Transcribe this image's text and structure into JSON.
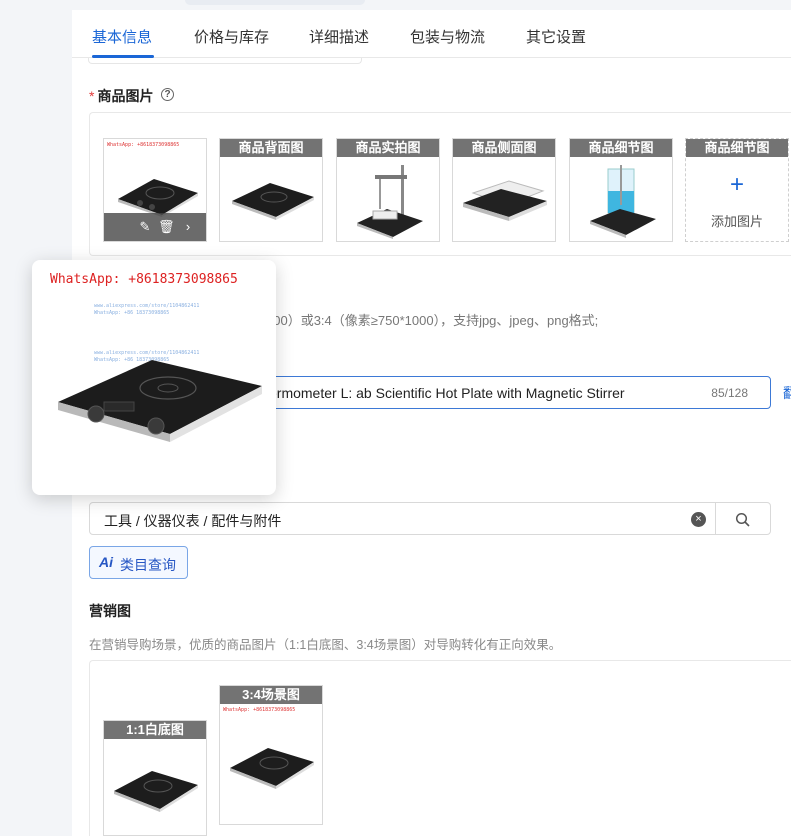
{
  "tabs": [
    {
      "label": "基本信息",
      "active": true
    },
    {
      "label": "价格与库存",
      "active": false
    },
    {
      "label": "详细描述",
      "active": false
    },
    {
      "label": "包装与物流",
      "active": false
    },
    {
      "label": "其它设置",
      "active": false
    }
  ],
  "product_images": {
    "required_mark": "*",
    "label": "商品图片",
    "help_glyph": "?",
    "watermark": "WhatsApp: +8618373098865",
    "slots": [
      {
        "label": "",
        "kind": "main"
      },
      {
        "label": "商品背面图"
      },
      {
        "label": "商品实拍图"
      },
      {
        "label": "商品侧面图"
      },
      {
        "label": "商品细节图"
      }
    ],
    "add_slot": {
      "label": "商品细节图",
      "plus": "+",
      "text": "添加图片"
    },
    "hint": "800）或3:4（像素≥750*1000），支持jpg、jpeg、png格式;"
  },
  "popup": {
    "watermark": "WhatsApp: +8618373098865",
    "faint_lines": [
      "www.aliexpress.com/store/1104862411",
      "WhatsApp: +86 18373098865"
    ]
  },
  "title_field": {
    "value": "ermometer L: ab Scientific Hot Plate with Magnetic Stirrer",
    "count": "85/128",
    "edge_link": "翻"
  },
  "category": {
    "value": "工具 / 仪器仪表 / 配件与附件",
    "clear_glyph": "×"
  },
  "ai_button": {
    "icon": "Ai",
    "label": "类目查询"
  },
  "marketing": {
    "label": "营销图",
    "hint": "在营销导购场景，优质的商品图片（1:1白底图、3:4场景图）对导购转化有正向效果。",
    "slots": [
      {
        "label": "1:1白底图"
      },
      {
        "label": "3:4场景图"
      }
    ]
  },
  "colors": {
    "accent": "#1a66d6",
    "required": "#e23b3b",
    "watermark": "#d22222"
  }
}
